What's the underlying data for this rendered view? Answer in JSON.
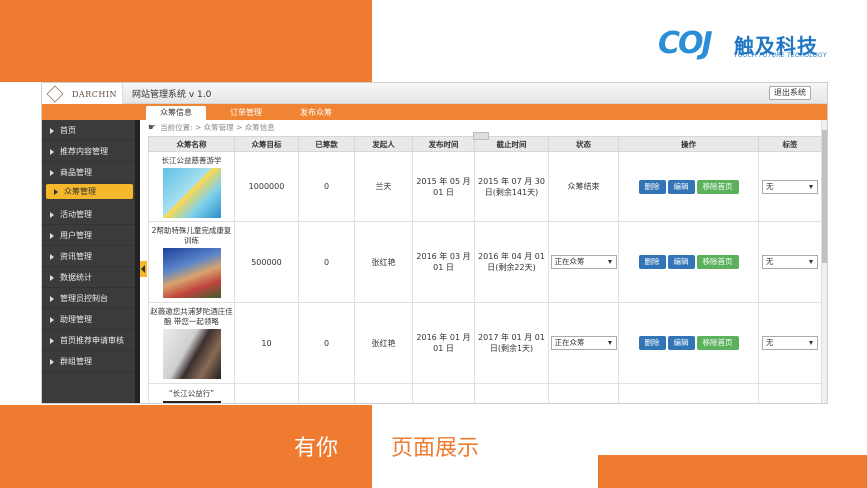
{
  "brand": {
    "logo_text": "COJ",
    "name_cn": "触及科技",
    "name_en": "TOUCH FUTURE TECHOLOGY"
  },
  "captions": {
    "left": "有你",
    "right": "页面展示"
  },
  "window": {
    "logo_text": "DARCHIN",
    "system_title": "网站管理系统 v 1.0",
    "logout_label": "退出系统"
  },
  "tabs": [
    {
      "label": "众筹信息",
      "active": true
    },
    {
      "label": "订单管理",
      "active": false
    },
    {
      "label": "发布众筹",
      "active": false
    }
  ],
  "sidebar": {
    "items": [
      {
        "label": "首页"
      },
      {
        "label": "推荐内容管理"
      },
      {
        "label": "商品管理"
      },
      {
        "label": "众筹管理",
        "active": true
      },
      {
        "label": "活动管理"
      },
      {
        "label": "用户管理"
      },
      {
        "label": "资讯管理"
      },
      {
        "label": "数据统计"
      },
      {
        "label": "管理员控制台"
      },
      {
        "label": "助理管理"
      },
      {
        "label": "首页推荐申请审核"
      },
      {
        "label": "群组管理"
      }
    ]
  },
  "breadcrumb": "当前位置: > 众筹管理 > 众筹信息",
  "table": {
    "headers": [
      "众筹名称",
      "众筹目标",
      "已筹款",
      "发起人",
      "发布时间",
      "截止时间",
      "状态",
      "操作",
      "标签"
    ],
    "buttons": {
      "delete": "删除",
      "edit": "编辑",
      "remove_home": "移除首页"
    },
    "rows": [
      {
        "name": "长江公益慈善游学",
        "target": "1000000",
        "raised": "0",
        "initiator": "兰天",
        "publish": "2015 年 05 月 01 日",
        "deadline": "2015 年 07 月 30 日(剩余141天)",
        "status_text": "众筹结束",
        "status_select": "",
        "tag": "无"
      },
      {
        "name": "2帮助特殊儿童完成康复训练",
        "target": "500000",
        "raised": "0",
        "initiator": "张红艳",
        "publish": "2016 年 03 月 01 日",
        "deadline": "2016 年 04 月 01 日(剩余22天)",
        "status_text": "",
        "status_select": "正在众筹",
        "tag": "无"
      },
      {
        "name": "赵薇邀您共浦梦陀酒庄佳酿 带您一起领略",
        "target": "10",
        "raised": "0",
        "initiator": "张红艳",
        "publish": "2016 年 01 月 01 日",
        "deadline": "2017 年 01 月 01 日(剩余1天)",
        "status_text": "",
        "status_select": "正在众筹",
        "tag": "无"
      },
      {
        "name": "“长江公益行”",
        "target": "",
        "raised": "",
        "initiator": "",
        "publish": "",
        "deadline": "",
        "status_text": "",
        "status_select": "",
        "tag": ""
      }
    ]
  },
  "colors": {
    "accent": "#ee7b30",
    "tab_bar": "#f18432",
    "sidebar": "#3b3b3b",
    "active_item": "#f5b72b",
    "btn_blue": "#3275b7",
    "btn_green": "#5cb25c"
  },
  "icons": {
    "breadcrumb": "hand-pointer-icon"
  }
}
